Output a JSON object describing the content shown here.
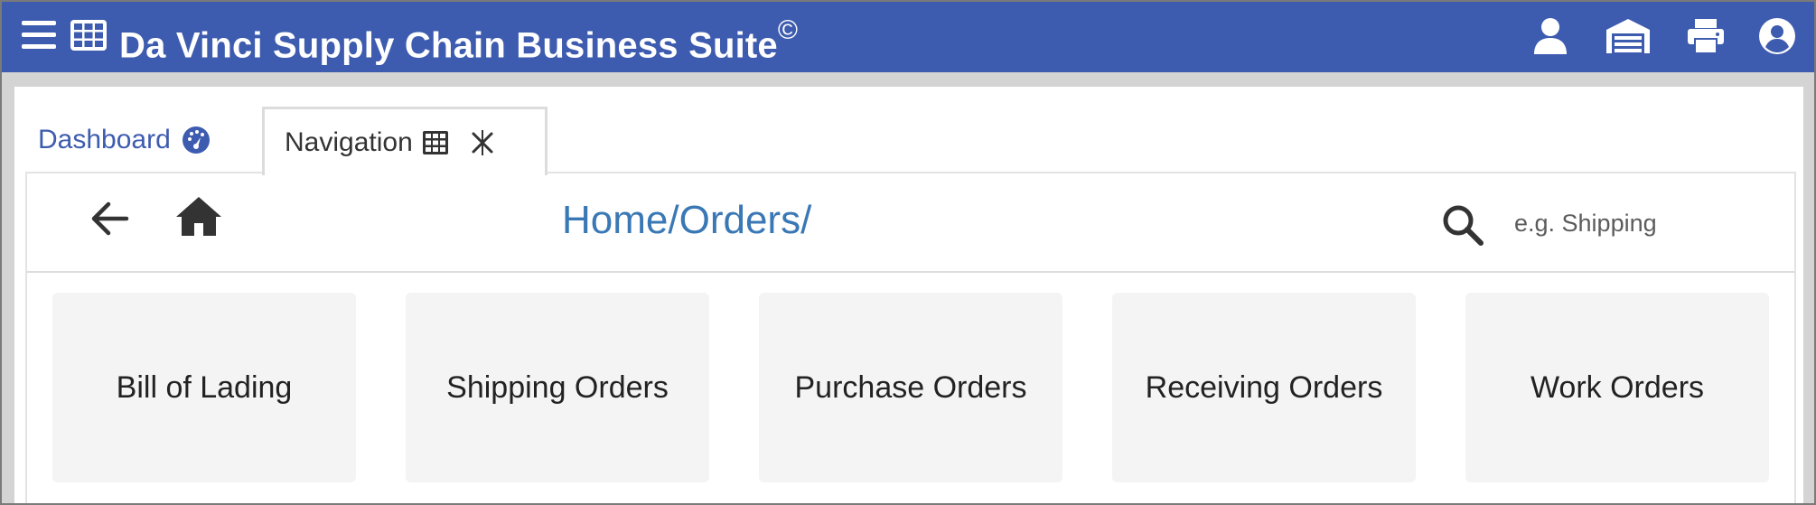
{
  "app": {
    "title": "Da Vinci Supply Chain Business Suite",
    "copyright_mark": "©",
    "bar_color": "#3e5caf"
  },
  "header_icons": [
    "menu-icon",
    "grid-icon",
    "user-icon",
    "garage-icon",
    "printer-icon",
    "account-icon"
  ],
  "tabs": [
    {
      "label": "Dashboard",
      "icon": "speedometer-icon",
      "active": false
    },
    {
      "label": "Navigation",
      "icon": "table-grid-icon",
      "active": true,
      "closable": true
    }
  ],
  "navbar": {
    "breadcrumb": "Home/Orders/",
    "search": {
      "placeholder": "e.g. Shipping",
      "value": ""
    }
  },
  "tiles": [
    {
      "label": "Bill of Lading"
    },
    {
      "label": "Shipping Orders"
    },
    {
      "label": "Purchase Orders"
    },
    {
      "label": "Receiving Orders"
    },
    {
      "label": "Work Orders"
    }
  ]
}
